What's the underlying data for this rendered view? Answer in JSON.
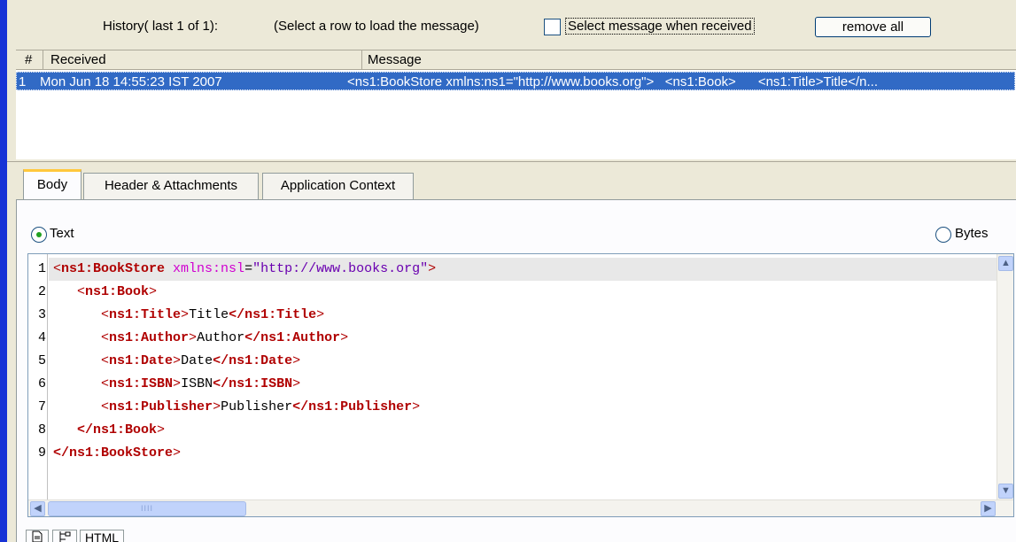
{
  "history": {
    "label": "History( last 1 of 1):",
    "hint": "(Select a row to load the message)",
    "select_when_received_label": "Select message when received",
    "remove_all_label": "remove all"
  },
  "table": {
    "columns": [
      "#",
      "Received",
      "Message"
    ],
    "rows": [
      {
        "num": "1",
        "received": "Mon Jun 18 14:55:23 IST 2007",
        "message": "<ns1:BookStore xmlns:ns1=\"http://www.books.org\">   <ns1:Book>      <ns1:Title>Title</n..."
      }
    ]
  },
  "tabs": [
    "Body",
    "Header & Attachments",
    "Application Context"
  ],
  "format": {
    "text_label": "Text",
    "bytes_label": "Bytes",
    "selected": "Text"
  },
  "editor": {
    "line_numbers": [
      "1",
      "2",
      "3",
      "4",
      "5",
      "6",
      "7",
      "8",
      "9"
    ],
    "lines": [
      {
        "indent": "",
        "open": "<",
        "tag": "ns1:BookStore",
        "attr": " xmlns:nsl",
        "eq": "=",
        "val": "\"http://www.books.org\"",
        "close": ">"
      },
      {
        "indent": "   ",
        "open": "<",
        "tag": "ns1:Book",
        "close": ">"
      },
      {
        "indent": "      ",
        "open": "<",
        "tag": "ns1:Title",
        "close": ">",
        "text": "Title",
        "end": "</ns1:Title",
        "endclose": ">"
      },
      {
        "indent": "      ",
        "open": "<",
        "tag": "ns1:Author",
        "close": ">",
        "text": "Author",
        "end": "</ns1:Author",
        "endclose": ">"
      },
      {
        "indent": "      ",
        "open": "<",
        "tag": "ns1:Date",
        "close": ">",
        "text": "Date",
        "end": "</ns1:Date",
        "endclose": ">"
      },
      {
        "indent": "      ",
        "open": "<",
        "tag": "ns1:ISBN",
        "close": ">",
        "text": "ISBN",
        "end": "</ns1:ISBN",
        "endclose": ">"
      },
      {
        "indent": "      ",
        "open": "<",
        "tag": "ns1:Publisher",
        "close": ">",
        "text": "Publisher",
        "end": "</ns1:Publisher",
        "endclose": ">"
      },
      {
        "indent": "   ",
        "end": "</ns1:Book",
        "endclose": ">"
      },
      {
        "indent": "",
        "end": "</ns1:BookStore",
        "endclose": ">"
      }
    ],
    "hscroll_grip": "IIII"
  },
  "view_tabs": {
    "doc_icon": "document-icon",
    "tree_icon": "tree-icon",
    "html_label": "HTML"
  },
  "colors": {
    "accent_stripe": "#1733d6",
    "selection": "#316ac5",
    "xml_tag": "#b00000",
    "xml_attr": "#d000d0",
    "xml_value": "#6a00b0"
  }
}
